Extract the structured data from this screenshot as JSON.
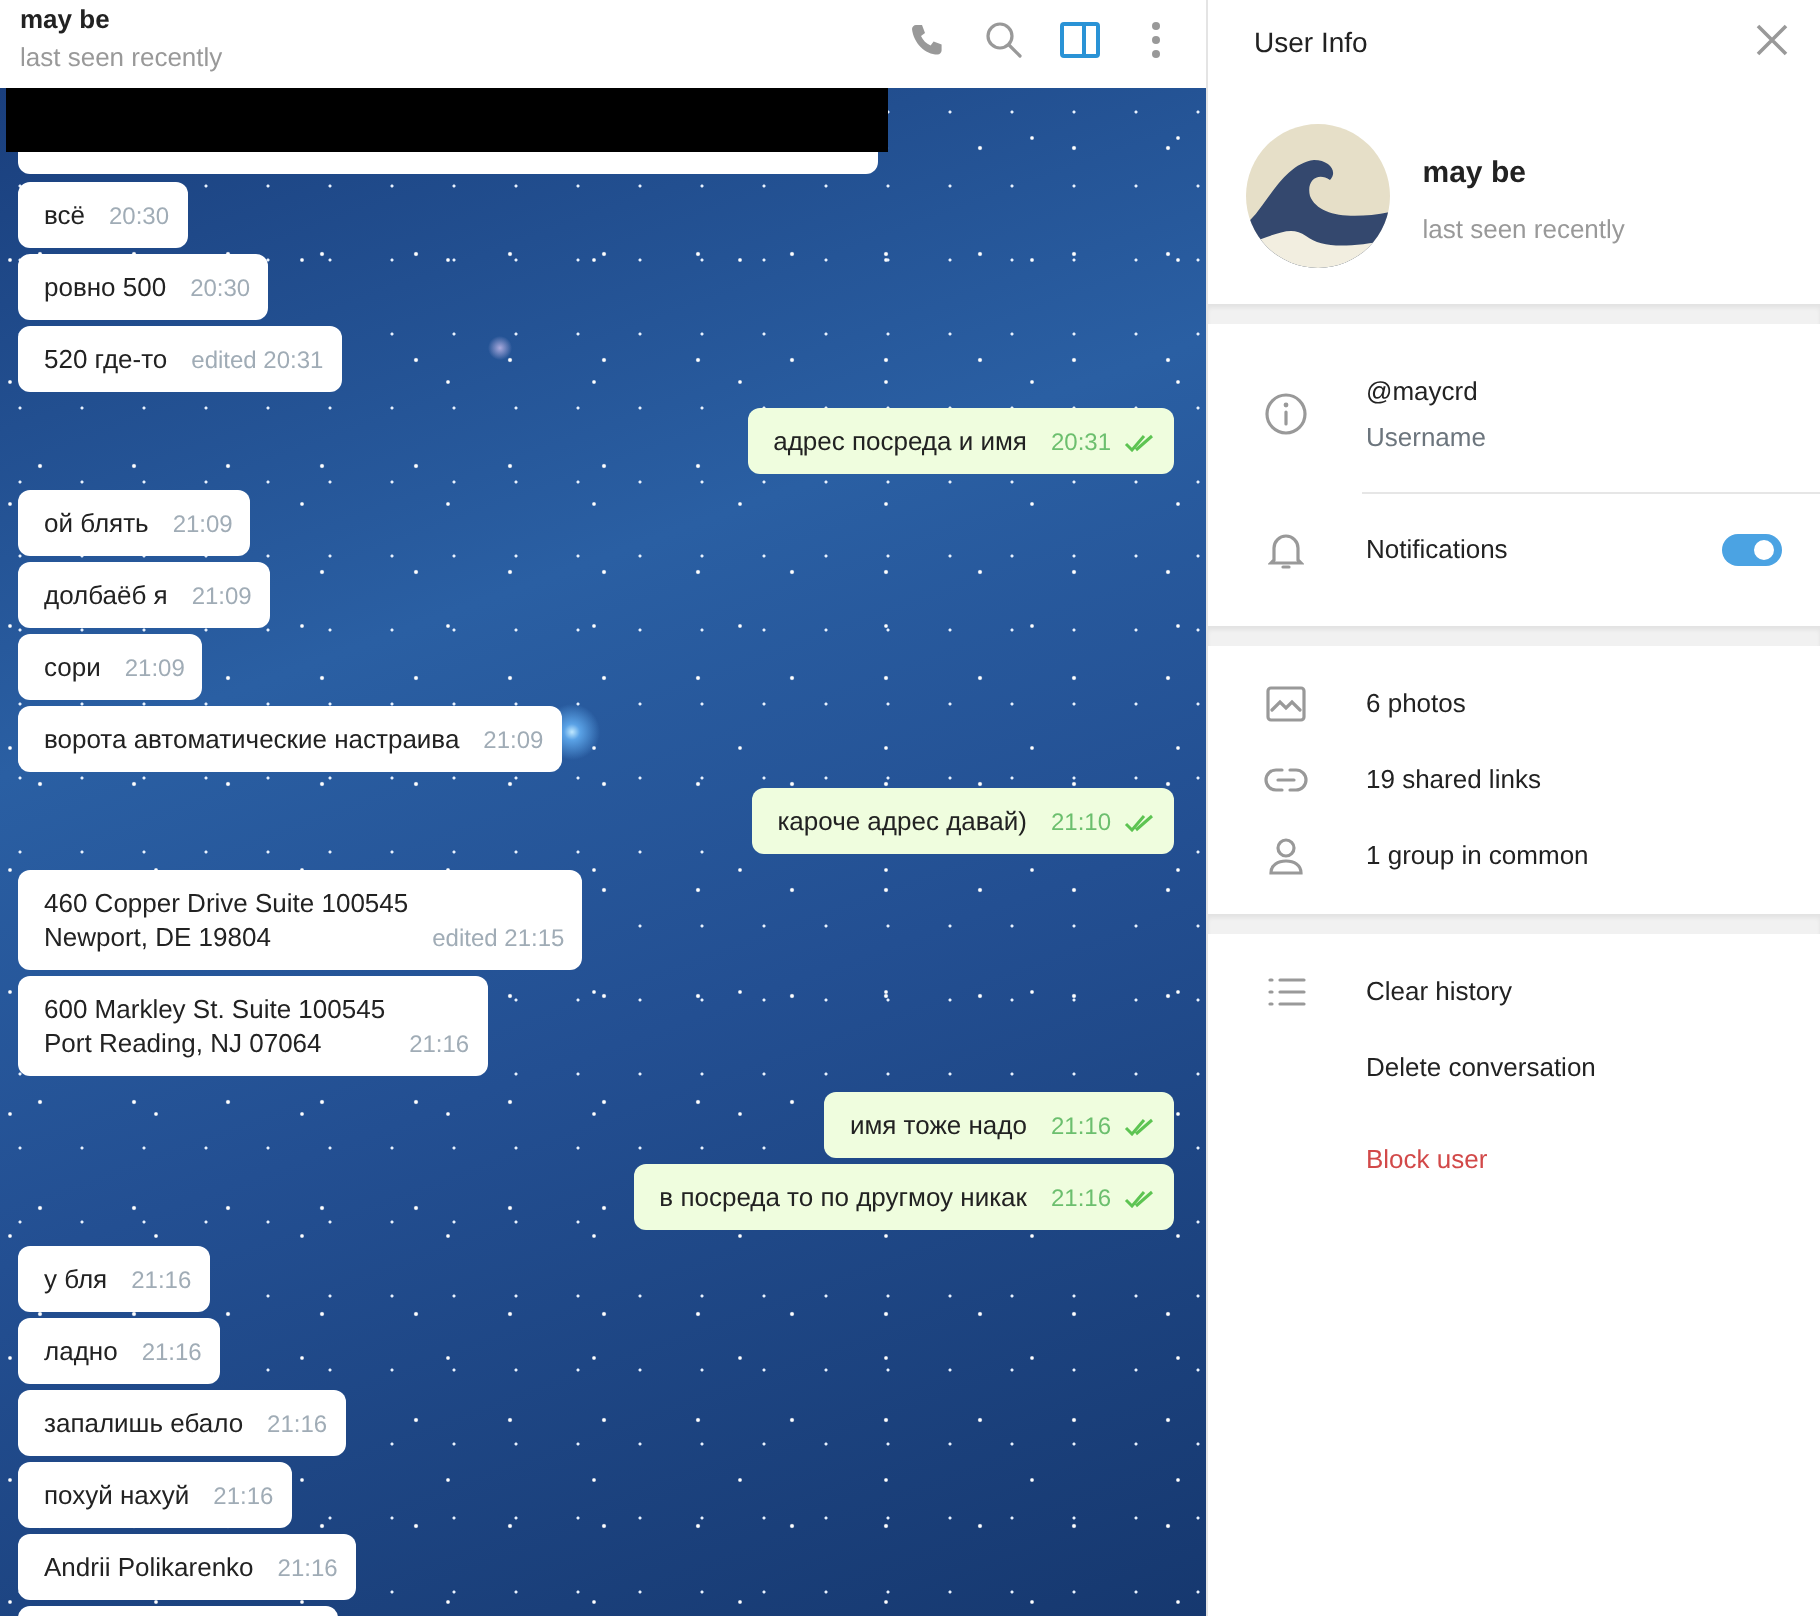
{
  "chat_header": {
    "name": "may be",
    "status": "last seen recently",
    "buttons": [
      {
        "kind": "phone",
        "selected": false
      },
      {
        "kind": "search",
        "selected": false
      },
      {
        "kind": "panel",
        "selected": true
      },
      {
        "kind": "more",
        "selected": false
      }
    ]
  },
  "message_groups": [
    {
      "outgoing": false,
      "messages": [
        {
          "text": "всё",
          "time": "20:30"
        },
        {
          "text": "ровно 500",
          "time": "20:30"
        },
        {
          "text": "520 где-то",
          "time": "edited 20:31"
        }
      ]
    },
    {
      "outgoing": true,
      "messages": [
        {
          "text": "адрес посреда и имя",
          "time": "20:31",
          "read": true
        }
      ]
    },
    {
      "outgoing": false,
      "messages": [
        {
          "text": "ой блять",
          "time": "21:09"
        },
        {
          "text": "долбаёб я",
          "time": "21:09"
        },
        {
          "text": "сори",
          "time": "21:09"
        },
        {
          "text": "ворота автоматические настраива",
          "time": "21:09"
        }
      ]
    },
    {
      "outgoing": true,
      "messages": [
        {
          "text": "кароче адрес давай)",
          "time": "21:10",
          "read": true
        }
      ]
    },
    {
      "outgoing": false,
      "messages": [
        {
          "text": "460 Copper Drive Suite 100545\nNewport, DE 19804",
          "time": "edited 21:15"
        },
        {
          "text": "600 Markley St. Suite 100545\nPort Reading, NJ 07064",
          "time": "21:16"
        }
      ]
    },
    {
      "outgoing": true,
      "messages": [
        {
          "text": "имя тоже надо",
          "time": "21:16",
          "read": true
        },
        {
          "text": "в посреда то по другмоу никак",
          "time": "21:16",
          "read": true
        }
      ]
    },
    {
      "outgoing": false,
      "messages": [
        {
          "text": "у бля",
          "time": "21:16"
        },
        {
          "text": "ладно",
          "time": "21:16"
        },
        {
          "text": "запалишь ебало",
          "time": "21:16"
        },
        {
          "text": "похуй нахуй",
          "time": "21:16"
        },
        {
          "text": "Andrii Polikarenko",
          "time": "21:16"
        }
      ]
    }
  ],
  "user_info": {
    "title": "User Info",
    "profile": {
      "name": "may be",
      "status": "last seen recently"
    },
    "sections": [
      {
        "rows": [
          {
            "kind": "detail",
            "value": "@maycrd",
            "label": "Username"
          },
          {
            "kind": "toggle",
            "label": "Notifications",
            "on": true
          }
        ]
      },
      {
        "rows": [
          {
            "kind": "plain",
            "label": "6 photos"
          },
          {
            "kind": "plain",
            "label": "19 shared links"
          },
          {
            "kind": "plain",
            "label": "1 group in common"
          }
        ]
      },
      {
        "rows": [
          {
            "kind": "plain",
            "label": "Clear history"
          },
          {
            "kind": "plain",
            "label": "Delete conversation"
          },
          {
            "kind": "danger",
            "label": "Block user"
          }
        ]
      }
    ]
  }
}
